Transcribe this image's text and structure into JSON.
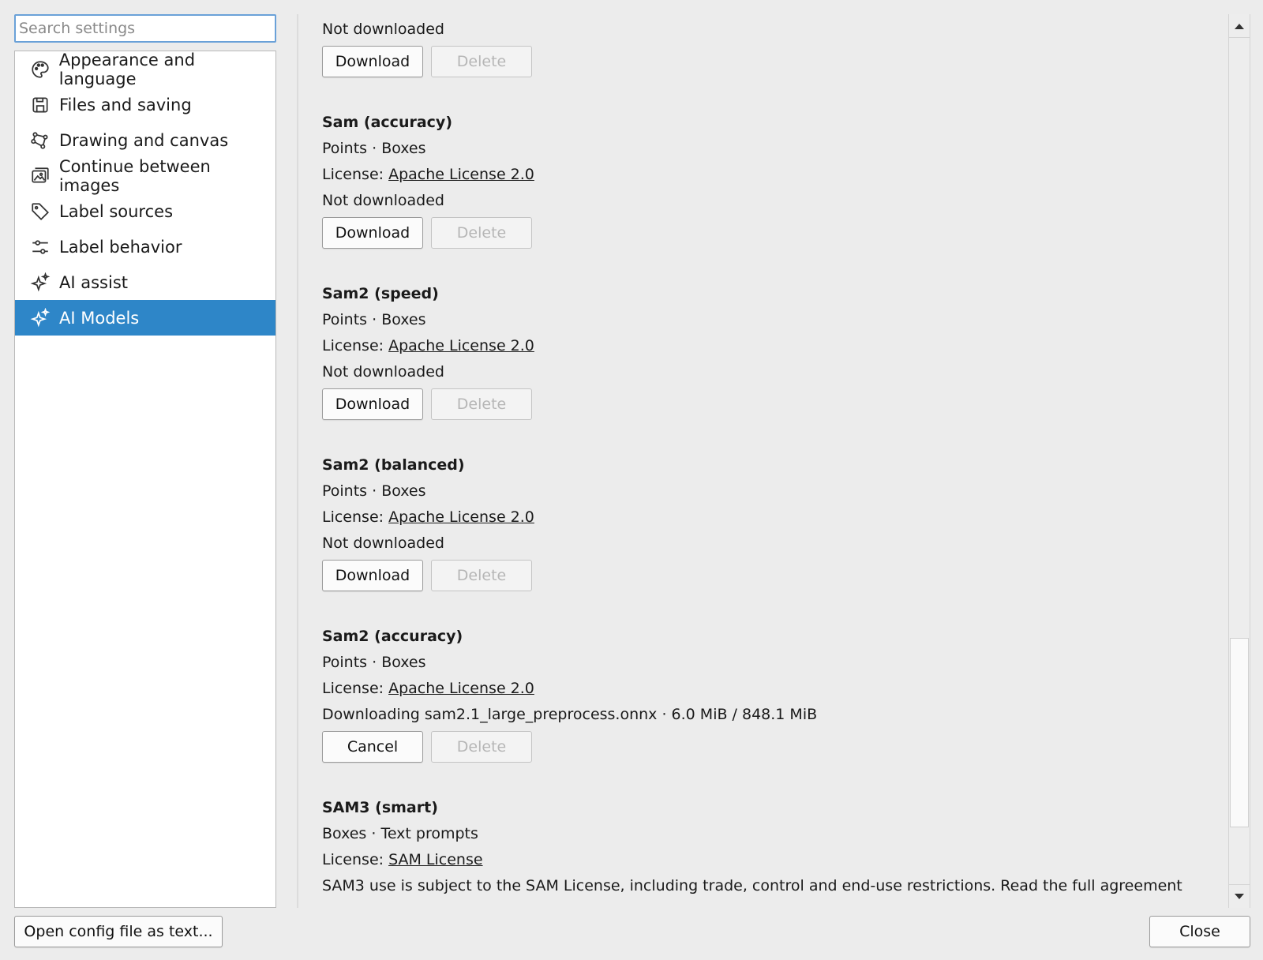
{
  "search": {
    "placeholder": "Search settings",
    "value": ""
  },
  "sidebar": {
    "items": [
      {
        "label": "Appearance and language",
        "icon": "palette-icon",
        "active": false
      },
      {
        "label": "Files and saving",
        "icon": "floppy-icon",
        "active": false
      },
      {
        "label": "Drawing and canvas",
        "icon": "polygon-icon",
        "active": false
      },
      {
        "label": "Continue between images",
        "icon": "images-icon",
        "active": false
      },
      {
        "label": "Label sources",
        "icon": "tag-icon",
        "active": false
      },
      {
        "label": "Label behavior",
        "icon": "sliders-icon",
        "active": false
      },
      {
        "label": "AI assist",
        "icon": "sparkle-icon",
        "active": false
      },
      {
        "label": "AI Models",
        "icon": "sparkle-icon",
        "active": true
      }
    ]
  },
  "content": {
    "top_status": "Not downloaded",
    "top_primary": "Download",
    "top_secondary": "Delete",
    "models": [
      {
        "name": "Sam (accuracy)",
        "capabilities": "Points · Boxes",
        "license_prefix": "License: ",
        "license_link": "Apache License 2.0",
        "status": "Not downloaded",
        "primary": "Download",
        "secondary": "Delete"
      },
      {
        "name": "Sam2 (speed)",
        "capabilities": "Points · Boxes",
        "license_prefix": "License: ",
        "license_link": "Apache License 2.0",
        "status": "Not downloaded",
        "primary": "Download",
        "secondary": "Delete"
      },
      {
        "name": "Sam2 (balanced)",
        "capabilities": "Points · Boxes",
        "license_prefix": "License: ",
        "license_link": "Apache License 2.0",
        "status": "Not downloaded",
        "primary": "Download",
        "secondary": "Delete"
      },
      {
        "name": "Sam2 (accuracy)",
        "capabilities": "Points · Boxes",
        "license_prefix": "License: ",
        "license_link": "Apache License 2.0",
        "status": "Downloading sam2.1_large_preprocess.onnx · 6.0 MiB / 848.1 MiB",
        "primary": "Cancel",
        "secondary": "Delete"
      },
      {
        "name": "SAM3 (smart)",
        "capabilities": "Boxes · Text prompts",
        "license_prefix": "License: ",
        "license_link": "SAM License",
        "status": "SAM3 use is subject to the SAM License, including trade, control and end-use restrictions. Read the full agreement"
      }
    ]
  },
  "footer": {
    "open_config_label": "Open config file as text...",
    "close_label": "Close"
  },
  "colors": {
    "accent": "#2e86c8",
    "focus_border": "#6aa1d8",
    "window_bg": "#ececec"
  }
}
